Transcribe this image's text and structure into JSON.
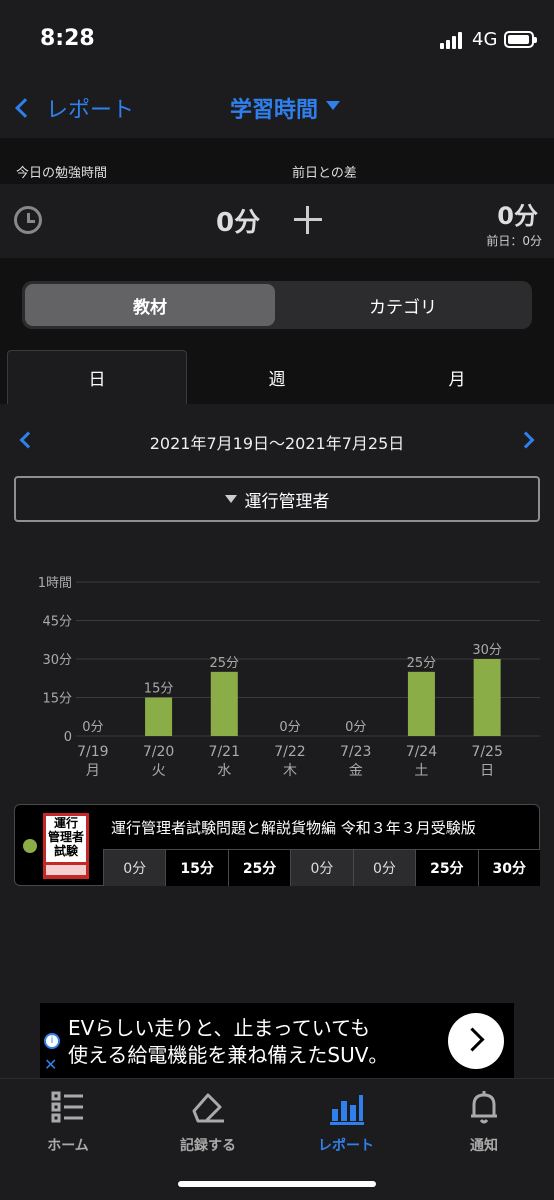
{
  "status": {
    "time": "8:28",
    "network": "4G"
  },
  "nav": {
    "back_label": "レポート",
    "title": "学習時間"
  },
  "today": {
    "label_today": "今日の勉強時間",
    "label_diff": "前日との差",
    "value": "0分",
    "diff_value": "0分",
    "prev_day": "前日：0分"
  },
  "segment": {
    "items": [
      "教材",
      "カテゴリ"
    ],
    "selected": "教材"
  },
  "period_tabs": {
    "items": [
      "日",
      "週",
      "月"
    ],
    "selected": "日"
  },
  "range": {
    "label": "2021年7月19日〜2021年7月25日"
  },
  "filter": {
    "selected": "運行管理者"
  },
  "colors": {
    "accent": "#2f80ed",
    "bar": "#8aad47"
  },
  "chart_data": {
    "type": "bar",
    "categories": [
      "7/19",
      "7/20",
      "7/21",
      "7/22",
      "7/23",
      "7/24",
      "7/25"
    ],
    "weekdays": [
      "月",
      "火",
      "水",
      "木",
      "金",
      "土",
      "日"
    ],
    "values": [
      0,
      15,
      25,
      0,
      0,
      25,
      30
    ],
    "value_labels": [
      "0分",
      "15分",
      "25分",
      "0分",
      "0分",
      "25分",
      "30分"
    ],
    "y_ticks": [
      {
        "value": 0,
        "label": "0"
      },
      {
        "value": 15,
        "label": "15分"
      },
      {
        "value": 30,
        "label": "30分"
      },
      {
        "value": 45,
        "label": "45分"
      },
      {
        "value": 60,
        "label": "1時間"
      }
    ],
    "ylim": [
      0,
      60
    ],
    "grid": true
  },
  "material_table": {
    "book_title": "運行管理者試験問題と解説貨物編 令和３年３月受験版",
    "cover_text": "運行 管理者 試験",
    "daily": [
      "0分",
      "15分",
      "25分",
      "0分",
      "0分",
      "25分",
      "30分"
    ]
  },
  "ad": {
    "line1": "EVらしい走りと、止まっていても",
    "line2": "使える給電機能を兼ね備えたSUV。"
  },
  "tabbar": {
    "items": [
      {
        "label": "ホーム",
        "icon": "list-icon"
      },
      {
        "label": "記録する",
        "icon": "pencil-icon"
      },
      {
        "label": "レポート",
        "icon": "bar-chart-icon"
      },
      {
        "label": "通知",
        "icon": "bell-icon"
      }
    ],
    "selected": "レポート"
  }
}
